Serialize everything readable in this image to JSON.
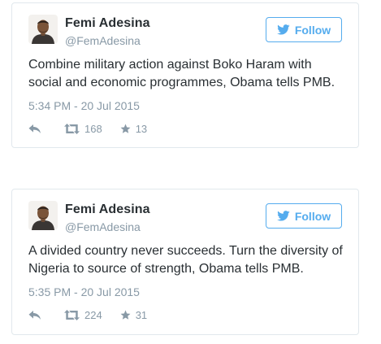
{
  "tweets": [
    {
      "author_name": "Femi Adesina",
      "author_handle": "@FemAdesina",
      "follow_label": "Follow",
      "text": "Combine military action against Boko Haram with social and economic programmes, Obama tells PMB.",
      "timestamp": "5:34 PM - 20 Jul 2015",
      "retweets": "168",
      "favorites": "13"
    },
    {
      "author_name": "Femi Adesina",
      "author_handle": "@FemAdesina",
      "follow_label": "Follow",
      "text": "A divided country never succeeds. Turn the diversity of Nigeria to source of strength, Obama tells PMB.",
      "timestamp": "5:35 PM - 20 Jul 2015",
      "retweets": "224",
      "favorites": "31"
    }
  ],
  "colors": {
    "accent": "#55acee",
    "text": "#292f33",
    "muted": "#8899a6",
    "border": "#e1e8ed"
  },
  "icons": {
    "follow": "twitter-bird-icon",
    "reply": "reply-icon",
    "retweet": "retweet-icon",
    "favorite": "star-icon"
  }
}
